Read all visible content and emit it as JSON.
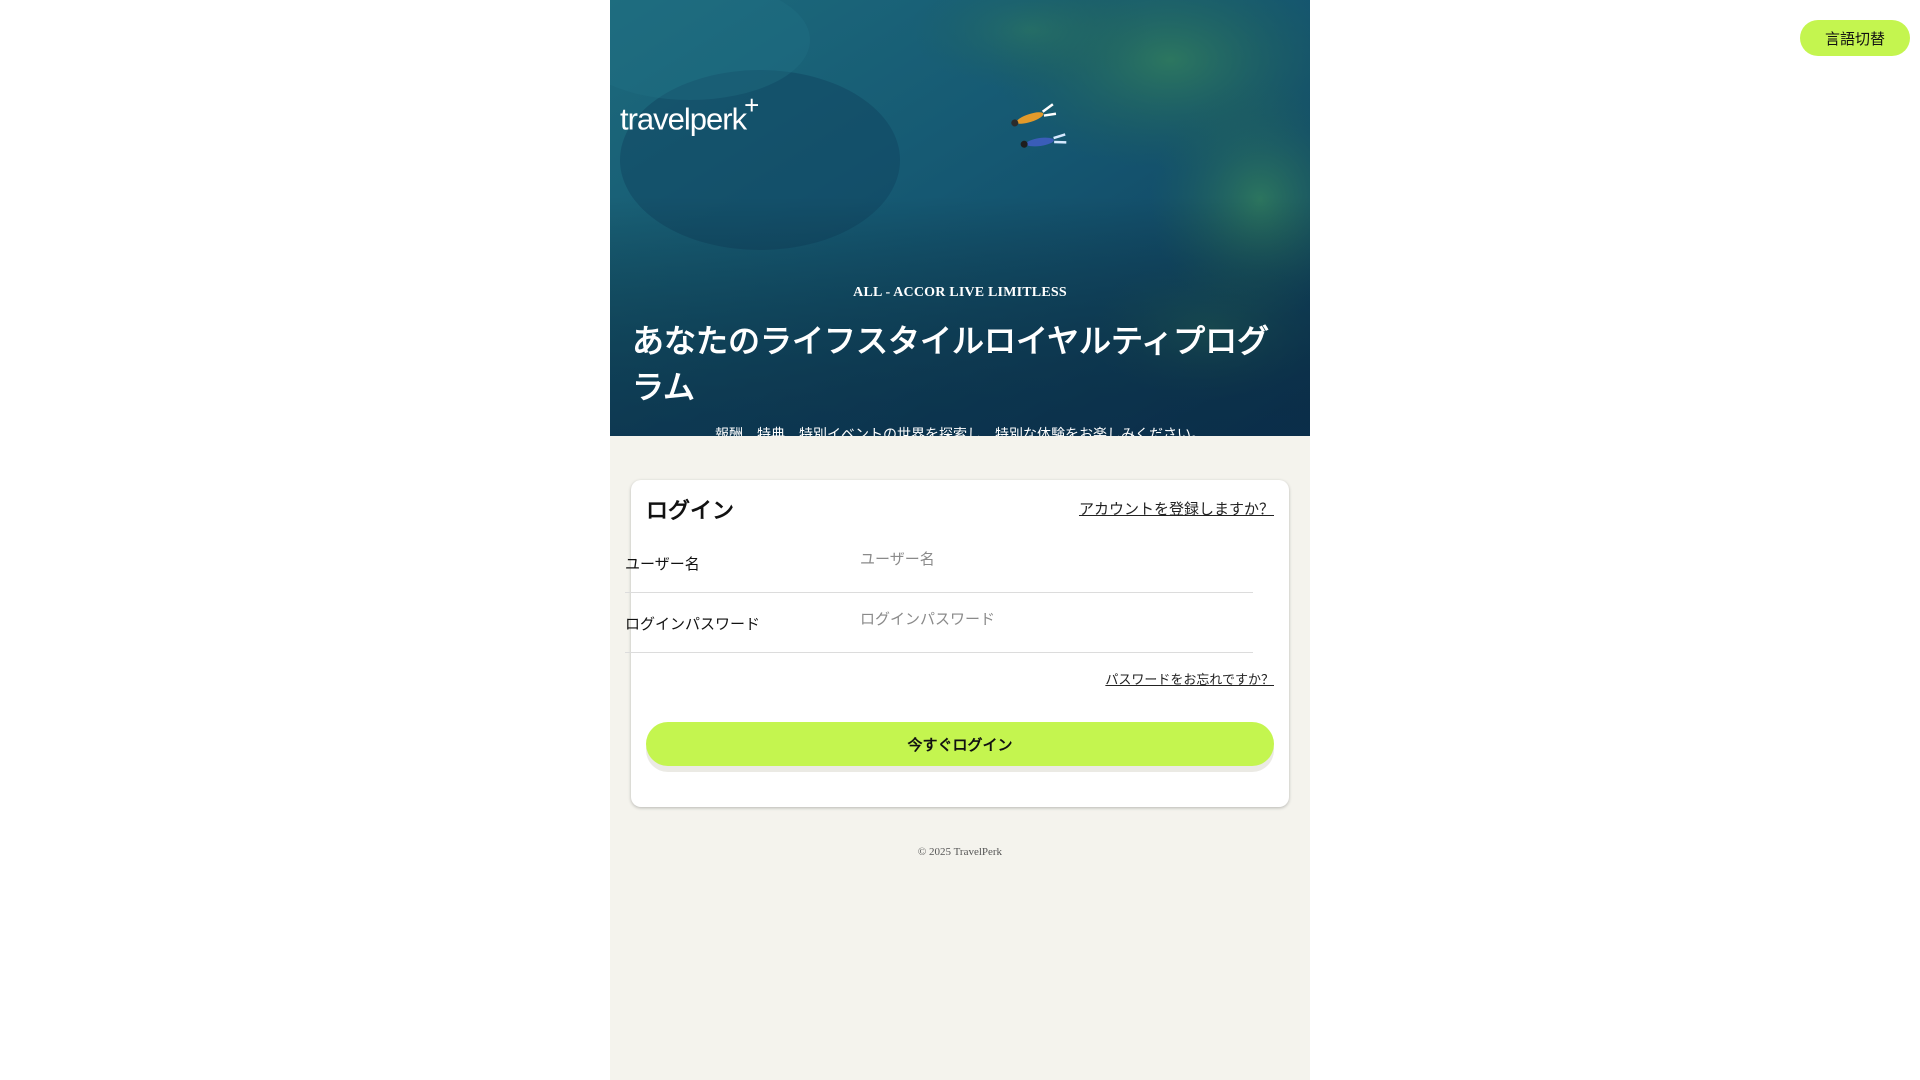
{
  "lang_switch": {
    "label": "言語切替"
  },
  "hero": {
    "brand": "travelperk",
    "brand_plus": "+",
    "eyebrow": "ALL - ACCOR LIVE LIMITLESS",
    "title": "あなたのライフスタイルロイヤルティプログラム",
    "subtitle": "報酬、特典、特別イベントの世界を探索し、特別な体験をお楽しみください。"
  },
  "login_card": {
    "title": "ログイン",
    "register_link": "アカウントを登録しますか？",
    "username": {
      "label": "ユーザー名",
      "placeholder": "ユーザー名",
      "value": ""
    },
    "password": {
      "label": "ログインパスワード",
      "placeholder": "ログインパスワード",
      "value": ""
    },
    "forgot_link": "パスワードをお忘れですか？",
    "submit_label": "今すぐログイン"
  },
  "footer": {
    "copyright": "© 2025 TravelPerk"
  },
  "colors": {
    "accent": "#c4f54f",
    "page_bg": "#f4f3ed",
    "hero_water": "#134a63"
  }
}
